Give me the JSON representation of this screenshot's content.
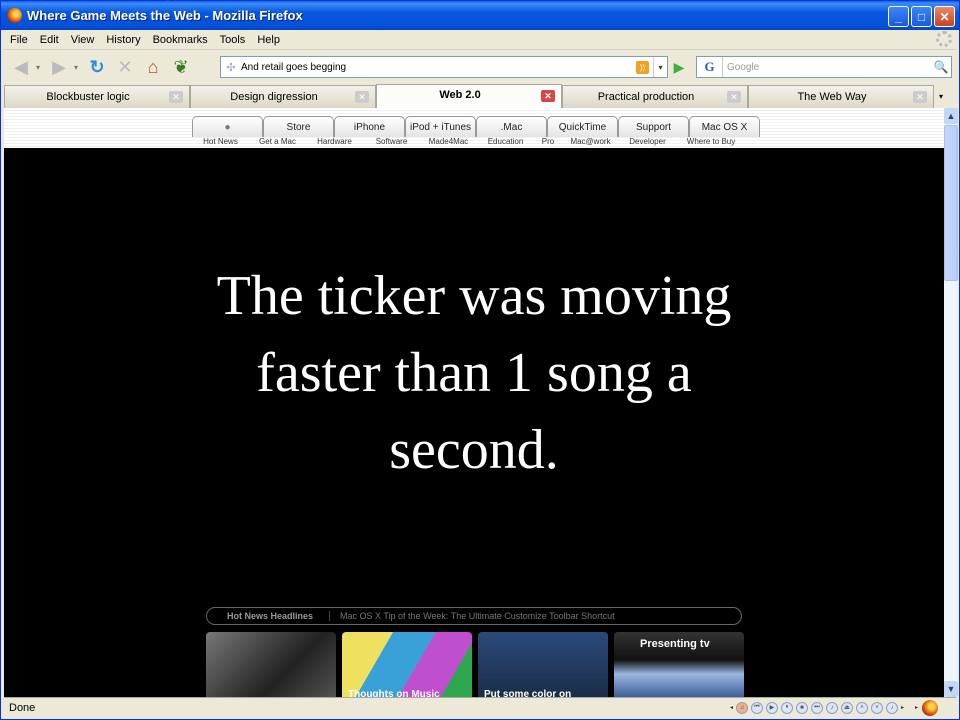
{
  "window": {
    "title": "Where Game Meets the Web - Mozilla Firefox",
    "min": "_",
    "max": "□",
    "close": "✕"
  },
  "menu": [
    "File",
    "Edit",
    "View",
    "History",
    "Bookmarks",
    "Tools",
    "Help"
  ],
  "nav": {
    "back": "◀",
    "forward": "▶",
    "dropdown": "▾",
    "reload": "↻",
    "stop": "✕",
    "home": "⌂",
    "leaf": "❦",
    "url": "And retail goes begging",
    "site_icon": "✣",
    "rss": "))",
    "go": "▶",
    "search_engine": "G",
    "search_placeholder": "Google",
    "search_icon": "🔍"
  },
  "tabs": [
    {
      "label": "Blockbuster logic",
      "active": false
    },
    {
      "label": "Design digression",
      "active": false
    },
    {
      "label": "Web 2.0",
      "active": true
    },
    {
      "label": "Practical production",
      "active": false
    },
    {
      "label": "The Web Way",
      "active": false
    }
  ],
  "tab_close": "✕",
  "tab_more": "▾",
  "apple": {
    "tabs": [
      "",
      "Store",
      "iPhone",
      "iPod + iTunes",
      ".Mac",
      "QuickTime",
      "Support",
      "Mac OS X"
    ],
    "apple_glyph": "●",
    "sub": [
      "Hot News",
      "Get a Mac",
      "Hardware",
      "Software",
      "Made4Mac",
      "Education",
      "Pro",
      "Mac@work",
      "Developer",
      "Where to Buy"
    ],
    "ticker_head": "Hot News Headlines",
    "ticker_text": "Mac OS X Tip of the Week: The Ultimate Customize Toolbar Shortcut",
    "promos": [
      "",
      "Thoughts on Music",
      "Put some color on",
      "Presenting  tv"
    ]
  },
  "slide": {
    "lines": [
      "The ticker was moving",
      "faster than 1 song a",
      "second."
    ]
  },
  "scroll": {
    "up": "▲",
    "down": "▼"
  },
  "status": {
    "text": "Done"
  },
  "player": {
    "prev_arrow": "◂",
    "music": "♫",
    "controls": [
      "⏮",
      "▶",
      "⏸",
      "■",
      "⏭",
      "♪",
      "⏏",
      "˄",
      "˅",
      "♪"
    ],
    "next_arrow": "▸"
  }
}
